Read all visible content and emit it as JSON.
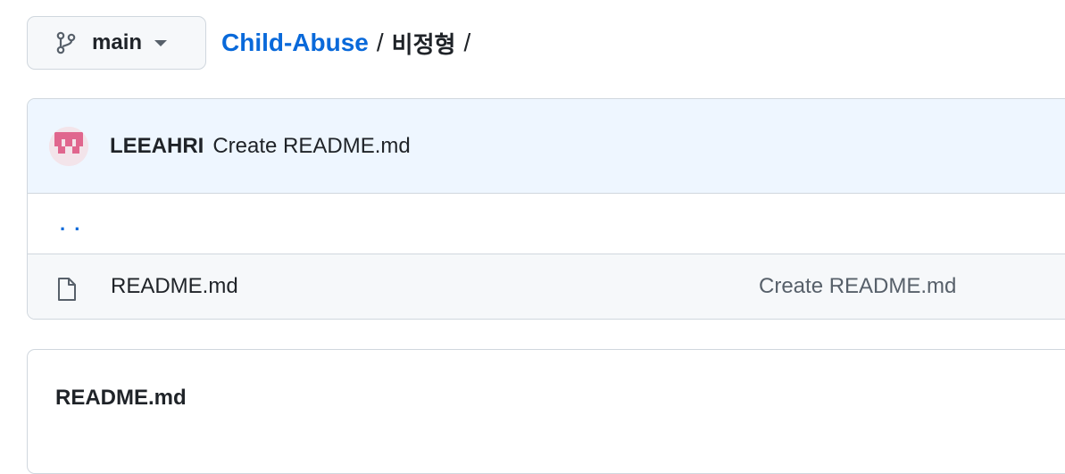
{
  "branch": {
    "name": "main"
  },
  "breadcrumb": {
    "repo": "Child-Abuse",
    "separator": "/",
    "current_folder": "비정형",
    "trailing_separator": "/"
  },
  "latest_commit": {
    "author": "LEEAHRI",
    "message": "Create README.md"
  },
  "parent_dir": {
    "label": ". ."
  },
  "files": [
    {
      "name": "README.md",
      "commit_message": "Create README.md",
      "icon": "file-icon"
    }
  ],
  "readme": {
    "title": "README.md"
  },
  "colors": {
    "link": "#0969da",
    "text": "#1f2328",
    "muted": "#57606a",
    "border": "#d0d7de",
    "commit_bar": "#eef6ff",
    "avatar_pink": "#e0668e"
  }
}
